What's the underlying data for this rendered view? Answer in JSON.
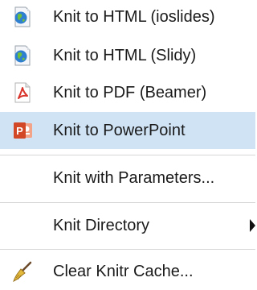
{
  "menu": {
    "items": [
      {
        "label": "Knit to HTML (ioslides)",
        "icon": "html-globe-icon"
      },
      {
        "label": "Knit to HTML (Slidy)",
        "icon": "html-globe-icon"
      },
      {
        "label": "Knit to PDF (Beamer)",
        "icon": "pdf-icon"
      },
      {
        "label": "Knit to PowerPoint",
        "icon": "powerpoint-icon",
        "highlighted": true
      },
      {
        "label": "Knit with Parameters..."
      },
      {
        "label": "Knit Directory",
        "has_submenu": true
      },
      {
        "label": "Clear Knitr Cache...",
        "icon": "broom-icon"
      }
    ]
  },
  "colors": {
    "highlight": "#cfe3f5",
    "separator": "#d6d6d6",
    "pdf_red": "#d9342b",
    "ppt_orange": "#d24726",
    "globe_blue": "#2f7fd0"
  }
}
